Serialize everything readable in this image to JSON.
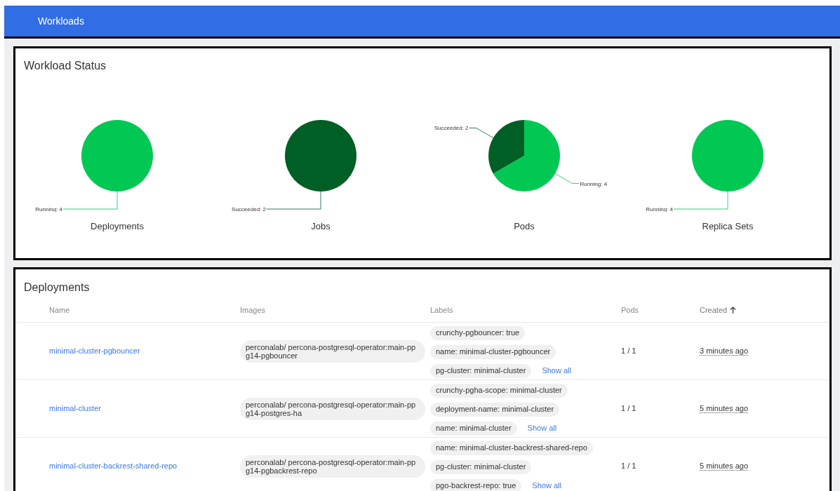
{
  "header": {
    "title": "Workloads"
  },
  "workload_status": {
    "title": "Workload Status",
    "charts": [
      {
        "chart_data": {
          "type": "pie",
          "title": "Deployments",
          "categories": [
            "Running: 4"
          ],
          "values": [
            100
          ],
          "colors": [
            "#00c853"
          ]
        }
      },
      {
        "chart_data": {
          "type": "pie",
          "title": "Jobs",
          "categories": [
            "Succeeded: 2"
          ],
          "values": [
            100
          ],
          "colors": [
            "#005f25"
          ]
        }
      },
      {
        "chart_data": {
          "type": "pie",
          "title": "Pods",
          "categories": [
            "Running: 4",
            "Succeeded: 2"
          ],
          "values": [
            66.67,
            33.33
          ],
          "colors": [
            "#00c853",
            "#005f25"
          ]
        }
      },
      {
        "chart_data": {
          "type": "pie",
          "title": "Replica Sets",
          "categories": [
            "Running: 4"
          ],
          "values": [
            100
          ],
          "colors": [
            "#00c853"
          ]
        }
      }
    ]
  },
  "deployments": {
    "title": "Deployments",
    "sort_ascending": true,
    "columns": [
      {
        "label": "Name",
        "sorted": false
      },
      {
        "label": "Images",
        "sorted": false
      },
      {
        "label": "Labels",
        "sorted": false
      },
      {
        "label": "Pods",
        "sorted": false
      },
      {
        "label": "Created",
        "sorted": true
      }
    ],
    "rows": [
      {
        "name": "minimal-cluster-pgbouncer",
        "image": "perconalab/ percona-postgresql-operator:main-pp g14-pgbouncer",
        "labels": [
          "crunchy-pgbouncer: true",
          "name: minimal-cluster-pgbouncer",
          "pg-cluster: minimal-cluster"
        ],
        "show_all": "Show all",
        "pods": "1 / 1",
        "created": "3 minutes ago"
      },
      {
        "name": "minimal-cluster",
        "image": "perconalab/ percona-postgresql-operator:main-pp g14-postgres-ha",
        "labels": [
          "crunchy-pgha-scope: minimal-cluster",
          "deployment-name: minimal-cluster",
          "name: minimal-cluster"
        ],
        "show_all": "Show all",
        "pods": "1 / 1",
        "created": "5 minutes ago"
      },
      {
        "name": "minimal-cluster-backrest-shared-repo",
        "image": "perconalab/ percona-postgresql-operator:main-pp g14-pgbackrest-repo",
        "labels": [
          "name: minimal-cluster-backrest-shared-repo",
          "pg-cluster: minimal-cluster",
          "pgo-backrest-repo: true"
        ],
        "show_all": "Show all",
        "pods": "1 / 1",
        "created": "5 minutes ago"
      }
    ]
  }
}
